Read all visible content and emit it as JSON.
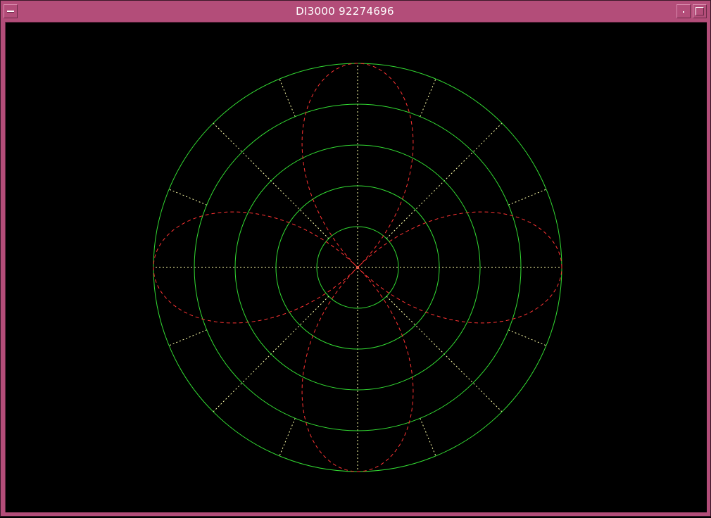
{
  "window": {
    "title": "DI3000 92274696"
  },
  "icons": {
    "menu": "window-menu-icon",
    "minimize": "minimize-icon",
    "maximize": "maximize-icon"
  },
  "colors": {
    "titlebar": "#b34d79",
    "background": "#000000",
    "grid_circles": "#33dd33",
    "radial_lines": "#ffffaa",
    "curve": "#ff3333"
  },
  "chart_data": {
    "type": "polar",
    "title": "",
    "rings": 5,
    "radial_spoke_angles_deg": [
      0,
      22.5,
      45,
      67.5,
      90,
      112.5,
      135,
      157.5,
      180,
      202.5,
      225,
      247.5,
      270,
      292.5,
      315,
      337.5
    ],
    "grid": true,
    "series": [
      {
        "style": "dashed",
        "lobes": 4,
        "lobe_axes_deg": [
          0,
          90,
          180,
          270
        ],
        "max_radius_rings": 5
      }
    ]
  }
}
